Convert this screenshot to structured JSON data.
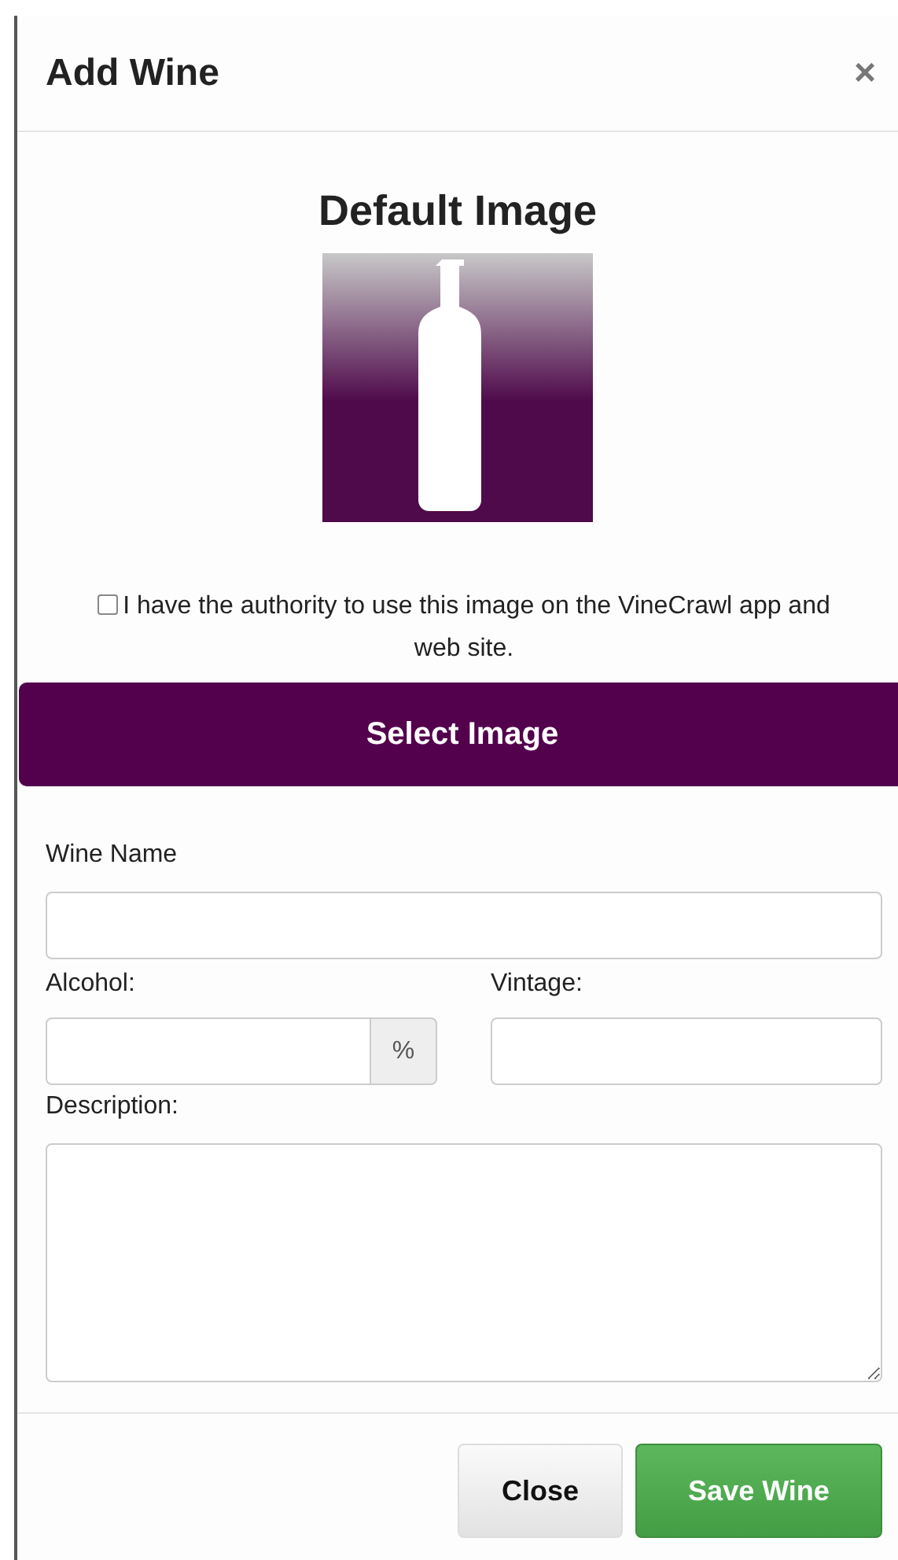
{
  "modal": {
    "title": "Add Wine",
    "close_icon": "×"
  },
  "image_section": {
    "heading": "Default Image"
  },
  "authority": {
    "checked": false,
    "label": "I have the authority to use this image on the VineCrawl app and web site."
  },
  "select_button": "Select Image",
  "fields": [
    {
      "kind": "text",
      "label": "Wine Name"
    },
    {
      "kind": "addon",
      "label": "Alcohol:",
      "addon": "%"
    },
    {
      "kind": "text",
      "label": "Vintage:"
    },
    {
      "kind": "textarea",
      "label": "Description:"
    }
  ],
  "buttons": [
    {
      "kind": "default",
      "label": "Close"
    },
    {
      "kind": "primary",
      "label": "Save Wine"
    }
  ]
}
